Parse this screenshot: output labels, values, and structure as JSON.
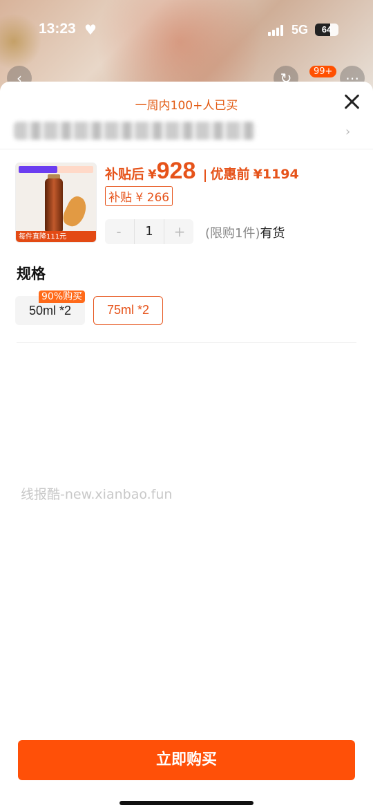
{
  "status_bar": {
    "time": "13:23",
    "network": "5G",
    "battery": "64",
    "battery_level": 0.64
  },
  "top_nav": {
    "cart_badge": "99+"
  },
  "sheet": {
    "week_bought": "一周内100+人已买",
    "product": {
      "price_prefix": "补贴后",
      "currency": "¥",
      "price_after": "928",
      "price_before_label": "优惠前",
      "price_before": "¥1194",
      "subsidy": "补贴 ¥ 266",
      "thumb_banner": "每件直降111元"
    },
    "quantity": {
      "minus": "-",
      "value": "1",
      "plus": "+",
      "limit": "(限购1件)",
      "stock": "有货"
    },
    "spec": {
      "title": "规格",
      "options": [
        {
          "label": "50ml *2",
          "badge": "90%购买",
          "selected": false
        },
        {
          "label": "75ml *2",
          "selected": true
        }
      ]
    },
    "watermark": "线报酷-new.xianbao.fun",
    "buy_button": "立即购买"
  },
  "colors": {
    "accent": "#e6531a",
    "buy_button": "#ff5008"
  }
}
